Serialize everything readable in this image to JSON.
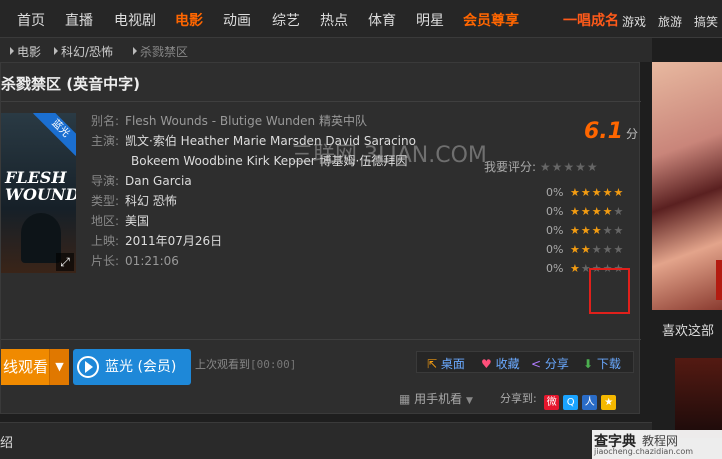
{
  "nav": {
    "items": [
      "首页",
      "直播",
      "电视剧",
      "电影",
      "动画",
      "综艺",
      "热点",
      "体育",
      "明星"
    ],
    "vip": "会员尊享",
    "promo": "一唱成名",
    "extra": [
      "游戏",
      "旅游",
      "搞笑"
    ]
  },
  "breadcrumb": [
    "电影",
    "科幻/恐怖",
    "杀戮禁区"
  ],
  "movie": {
    "title": "杀戮禁区 (英音中字)",
    "poster_title": "FLESH WOUNDS",
    "badge": "蓝光",
    "alias_label": "别名:",
    "alias": "Flesh Wounds - Blutige Wunden 精英中队",
    "cast_label": "主演:",
    "cast_line1": "凯文·索伯 Heather Marie Marsden David Saracino",
    "cast_line2": "Bokeem Woodbine Kirk Kepper 博基姆·伍德拜因",
    "director_label": "导演:",
    "director": "Dan Garcia",
    "genre_label": "类型:",
    "genre": "科幻 恐怖",
    "region_label": "地区:",
    "region": "美国",
    "release_label": "上映:",
    "release": "2011年07月26日",
    "length_label": "片长:",
    "length": "01:21:06",
    "watermark": "三联网 3LIAN.COM"
  },
  "rating": {
    "score": "6.1",
    "unit": "分",
    "my_rating_label": "我要评分:",
    "distribution": [
      {
        "percent": "0%",
        "stars": 5
      },
      {
        "percent": "0%",
        "stars": 4
      },
      {
        "percent": "0%",
        "stars": 3
      },
      {
        "percent": "0%",
        "stars": 2
      },
      {
        "percent": "0%",
        "stars": 1
      }
    ]
  },
  "actions": {
    "watch_label": "线观看",
    "bluray_label": "蓝光 (会员)",
    "last_watched_label": "上次观看到",
    "last_watched_time": "[00:00]",
    "desktop": "桌面",
    "favorite": "收藏",
    "share": "分享",
    "download": "下载",
    "mobile": "用手机看",
    "share_to": "分享到:"
  },
  "bottom_tab": "绍",
  "sidebar": {
    "heading": "喜欢这部"
  },
  "logo": {
    "brand": "查字典",
    "sub": "教程网",
    "url": "jiaocheng.chazidian.com"
  },
  "colors": {
    "accent": "#ff6600",
    "blue": "#1e88d8",
    "highlight": "#e0201b"
  }
}
